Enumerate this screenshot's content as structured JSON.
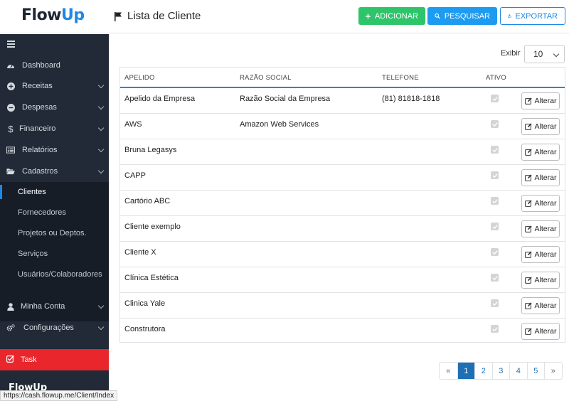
{
  "header": {
    "logo_flow": "Flow",
    "logo_up": "Up",
    "title": "Lista de Cliente",
    "add_label": "ADICIONAR",
    "search_label": "PESQUISAR",
    "export_label": "EXPORTAR"
  },
  "sidebar": {
    "items": [
      {
        "label": "Dashboard",
        "icon": "dashboard-icon"
      },
      {
        "label": "Receitas",
        "icon": "plus-circle-icon"
      },
      {
        "label": "Despesas",
        "icon": "minus-circle-icon"
      },
      {
        "label": "Financeiro",
        "icon": "dollar-icon"
      },
      {
        "label": "Relatórios",
        "icon": "report-icon"
      },
      {
        "label": "Cadastros",
        "icon": "folder-open-icon"
      },
      {
        "label": "Minha Conta",
        "icon": "user-icon"
      },
      {
        "label": "Configurações",
        "icon": "cogs-icon"
      }
    ],
    "submenu": [
      "Clientes",
      "Fornecedores",
      "Projetos ou Deptos.",
      "Serviços",
      "Usuários/Colaboradores"
    ],
    "task_label": "Task",
    "logo_text": "FlowUp"
  },
  "status_url": "https://cash.flowup.me/Client/Index",
  "page_size": {
    "label": "Exibir",
    "value": "10"
  },
  "table": {
    "headers": [
      "APELIDO",
      "RAZÃO SOCIAL",
      "TELEFONE",
      "ATIVO"
    ],
    "edit_label": "Alterar",
    "rows": [
      {
        "apelido": "Apelido da Empresa",
        "razao": "Razão Social da Empresa",
        "telefone": "(81) 81818-1818"
      },
      {
        "apelido": "AWS",
        "razao": "Amazon Web Services",
        "telefone": ""
      },
      {
        "apelido": "Bruna Legasys",
        "razao": "",
        "telefone": ""
      },
      {
        "apelido": "CAPP",
        "razao": "",
        "telefone": ""
      },
      {
        "apelido": "Cartório ABC",
        "razao": "",
        "telefone": ""
      },
      {
        "apelido": "Cliente exemplo",
        "razao": "",
        "telefone": ""
      },
      {
        "apelido": "Cliente X",
        "razao": "",
        "telefone": ""
      },
      {
        "apelido": "Clínica Estética",
        "razao": "",
        "telefone": ""
      },
      {
        "apelido": "Clinica Yale",
        "razao": "",
        "telefone": ""
      },
      {
        "apelido": "Construtora",
        "razao": "",
        "telefone": ""
      }
    ]
  },
  "pagination": {
    "prev": "«",
    "pages": [
      "1",
      "2",
      "3",
      "4",
      "5"
    ],
    "next": "»",
    "active": "1"
  },
  "colors": {
    "primary": "#1e88e5",
    "success": "#2ec56a",
    "sidebar": "#212a36",
    "task": "#e8262b"
  }
}
